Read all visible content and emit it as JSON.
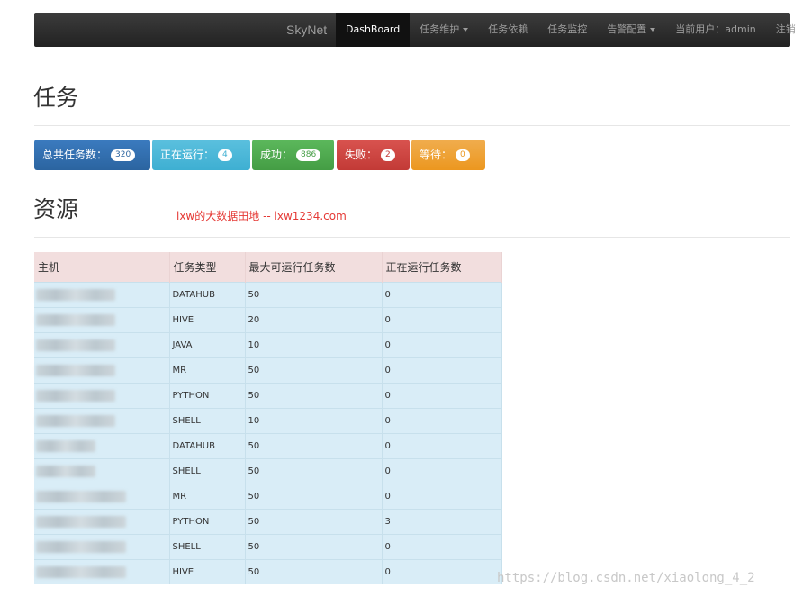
{
  "navbar": {
    "brand": "SkyNet",
    "items": [
      {
        "label": "DashBoard",
        "active": true
      },
      {
        "label": "任务维护",
        "dropdown": true
      },
      {
        "label": "任务依赖"
      },
      {
        "label": "任务监控"
      },
      {
        "label": "告警配置",
        "dropdown": true
      },
      {
        "label": "当前用户：admin"
      },
      {
        "label": "注销"
      }
    ]
  },
  "tasks_section": {
    "title": "任务",
    "stats": {
      "total_label": "总共任务数：",
      "total": "320",
      "running_label": "正在运行：",
      "running": "4",
      "success_label": "成功：",
      "success": "886",
      "failed_label": "失败：",
      "failed": "2",
      "waiting_label": "等待：",
      "waiting": "0"
    }
  },
  "resources_section": {
    "title": "资源",
    "watermark": "lxw的大数据田地 -- lxw1234.com",
    "columns": [
      "主机",
      "任务类型",
      "最大可运行任务数",
      "正在运行任务数"
    ],
    "rows": [
      {
        "type": "DATAHUB",
        "max": "50",
        "running": "0"
      },
      {
        "type": "HIVE",
        "max": "20",
        "running": "0"
      },
      {
        "type": "JAVA",
        "max": "10",
        "running": "0"
      },
      {
        "type": "MR",
        "max": "50",
        "running": "0"
      },
      {
        "type": "PYTHON",
        "max": "50",
        "running": "0"
      },
      {
        "type": "SHELL",
        "max": "10",
        "running": "0"
      },
      {
        "type": "DATAHUB",
        "max": "50",
        "running": "0"
      },
      {
        "type": "SHELL",
        "max": "50",
        "running": "0"
      },
      {
        "type": "MR",
        "max": "50",
        "running": "0"
      },
      {
        "type": "PYTHON",
        "max": "50",
        "running": "3"
      },
      {
        "type": "SHELL",
        "max": "50",
        "running": "0"
      },
      {
        "type": "HIVE",
        "max": "50",
        "running": "0"
      }
    ]
  },
  "page_watermark": "https://blog.csdn.net/xiaolong_4_2"
}
